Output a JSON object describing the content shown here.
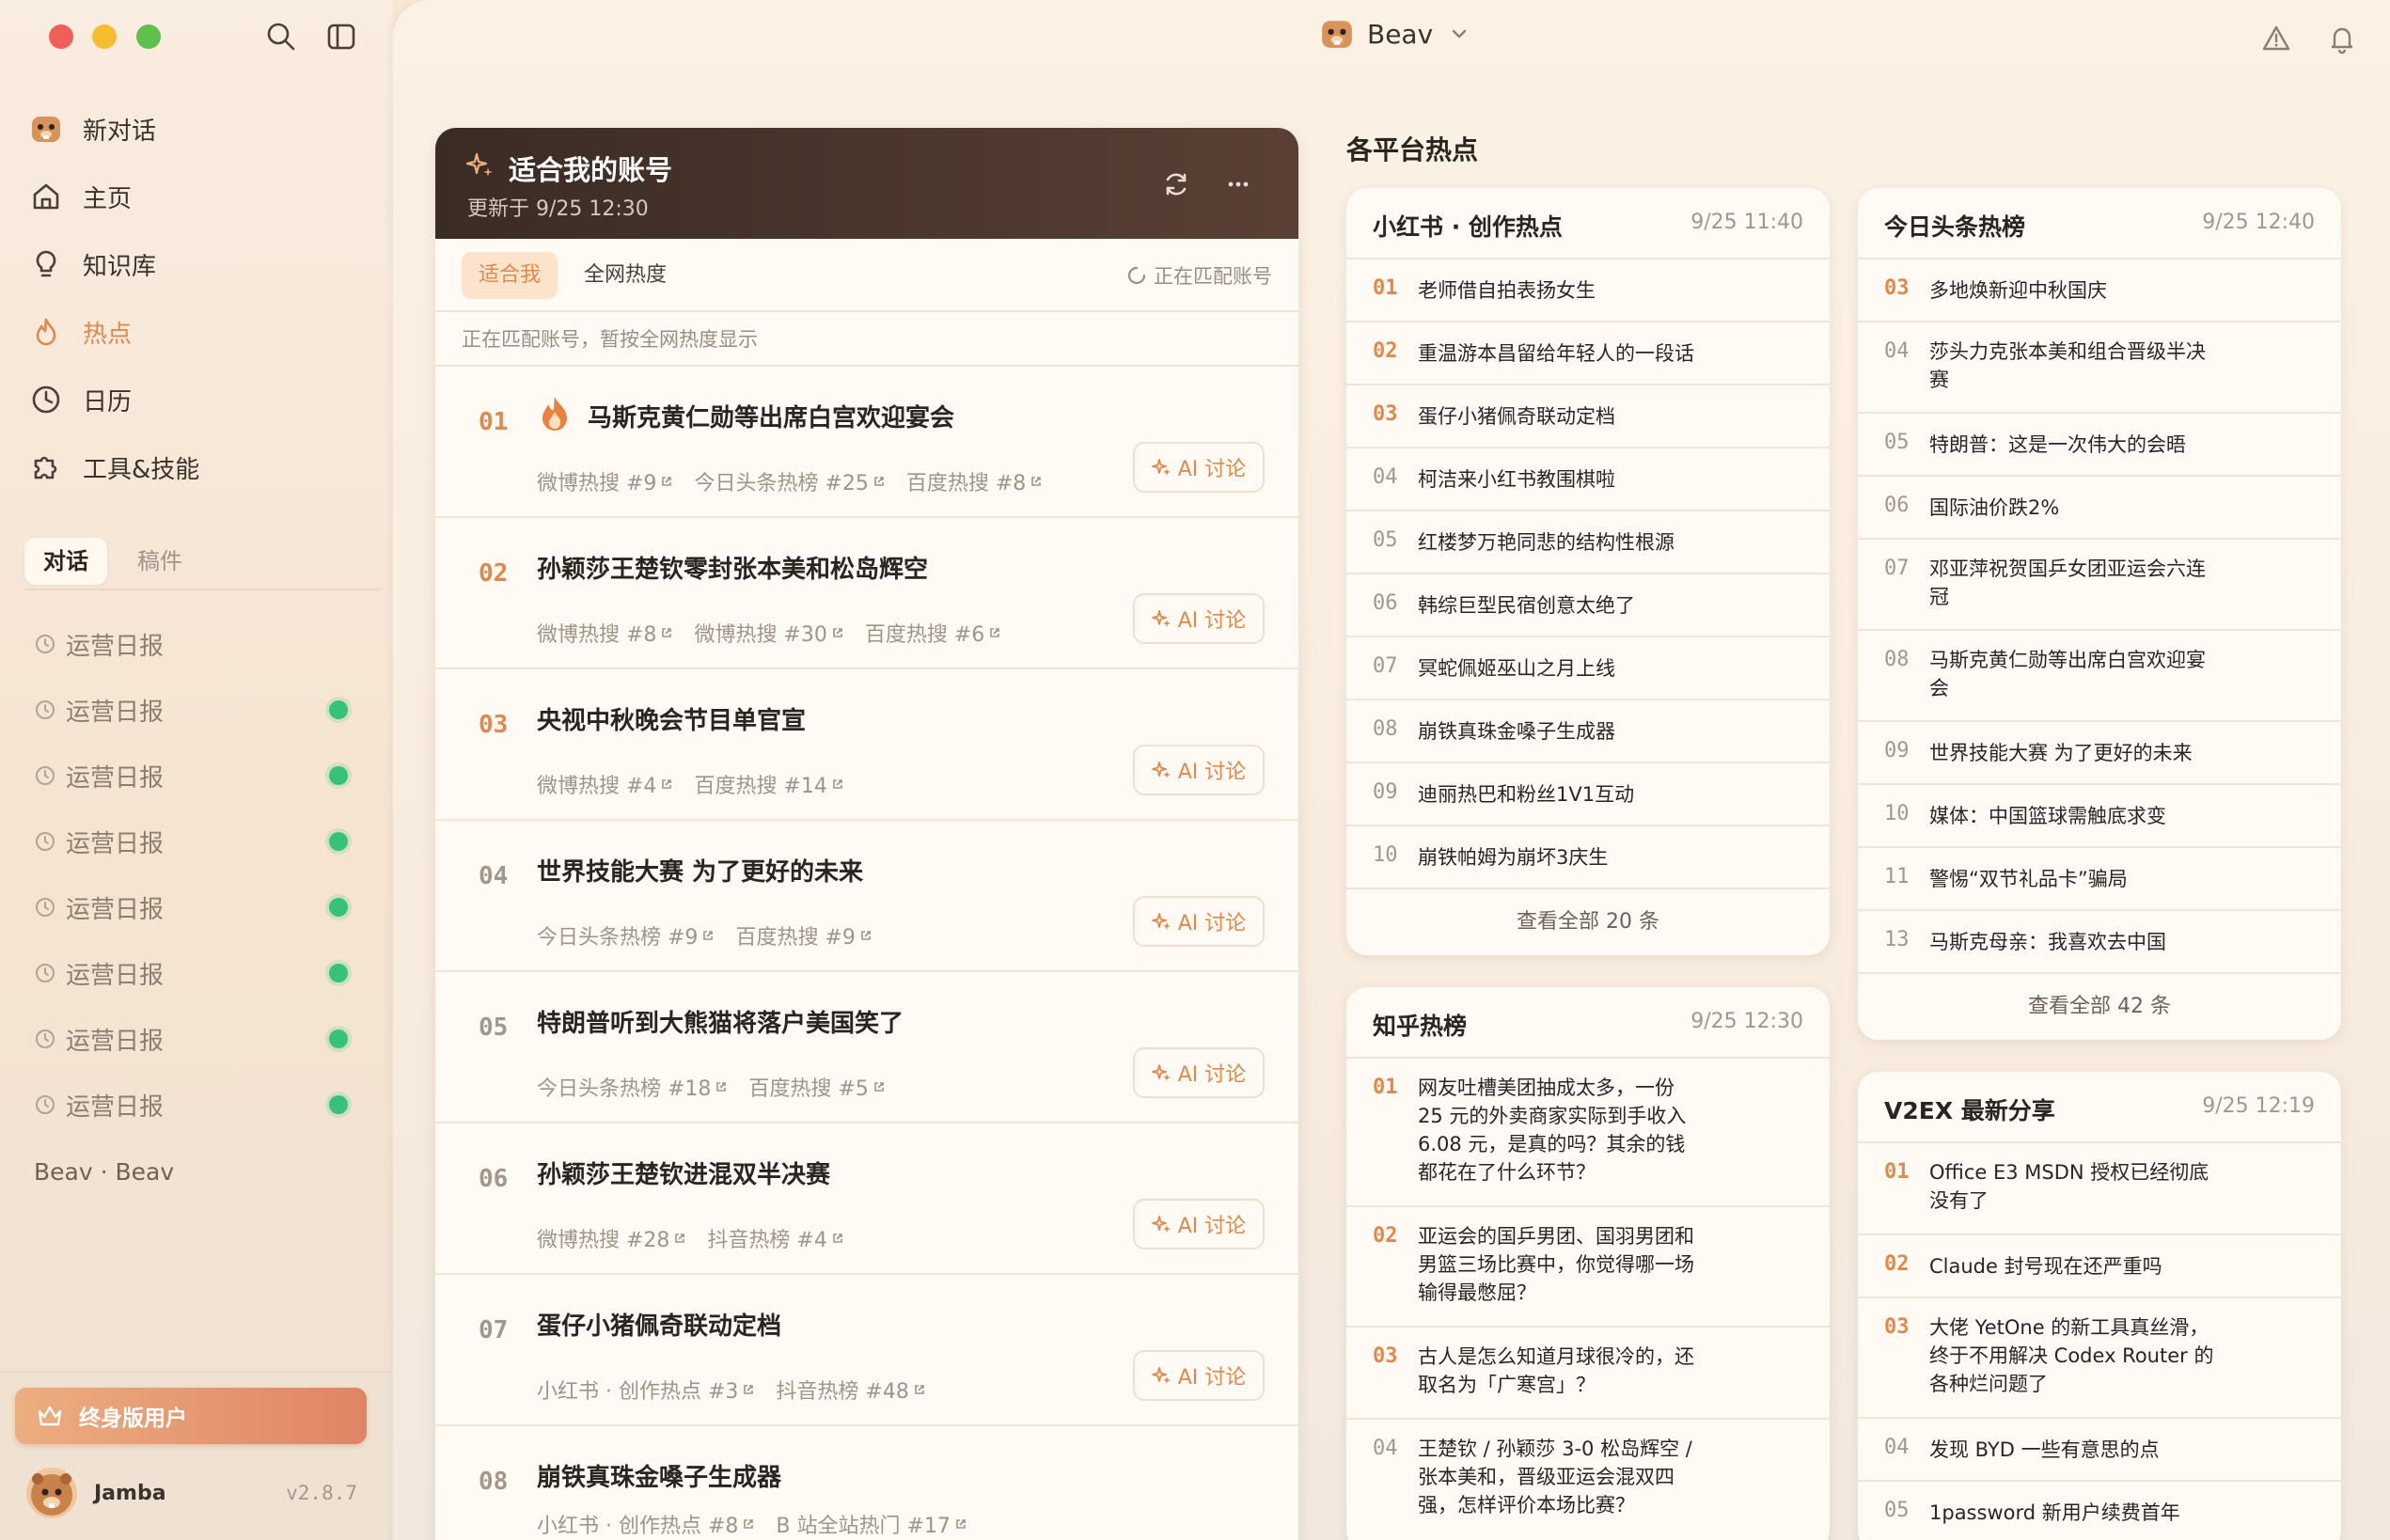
{
  "sidebar": {
    "nav": [
      {
        "label": "新对话",
        "icon": "beaver-icon"
      },
      {
        "label": "主页",
        "icon": "home-icon"
      },
      {
        "label": "知识库",
        "icon": "lightbulb-icon"
      },
      {
        "label": "热点",
        "icon": "flame-icon",
        "active": true
      },
      {
        "label": "日历",
        "icon": "clock-icon"
      },
      {
        "label": "工具&技能",
        "icon": "puzzle-icon"
      }
    ],
    "tabs": [
      "对话",
      "稿件"
    ],
    "history": [
      {
        "label": "运营日报",
        "dot": false
      },
      {
        "label": "运营日报",
        "dot": true
      },
      {
        "label": "运营日报",
        "dot": true
      },
      {
        "label": "运营日报",
        "dot": true
      },
      {
        "label": "运营日报",
        "dot": true
      },
      {
        "label": "运营日报",
        "dot": true
      },
      {
        "label": "运营日报",
        "dot": true
      },
      {
        "label": "运营日报",
        "dot": true
      }
    ],
    "footer_label": "Beav · Beav",
    "vip_label": "终身版用户",
    "user": {
      "name": "Jamba",
      "version": "v2.8.7"
    }
  },
  "header": {
    "title": "Beav"
  },
  "featured": {
    "title": "适合我的账号",
    "updated": "更新于 9/25 12:30",
    "filters": [
      "适合我",
      "全网热度"
    ],
    "matching": "正在匹配账号",
    "notice": "正在匹配账号，暂按全网热度显示",
    "ai_label": "AI 讨论",
    "items": [
      {
        "num": "01",
        "title": "马斯克黄仁勋等出席白宫欢迎宴会",
        "fire": true,
        "tags": [
          "微博热搜 #9",
          "今日头条热榜 #25",
          "百度热搜 #8"
        ]
      },
      {
        "num": "02",
        "title": "孙颖莎王楚钦零封张本美和松岛辉空",
        "tags": [
          "微博热搜 #8",
          "微博热搜 #30",
          "百度热搜 #6"
        ]
      },
      {
        "num": "03",
        "title": "央视中秋晚会节目单官宣",
        "tags": [
          "微博热搜 #4",
          "百度热搜 #14"
        ]
      },
      {
        "num": "04",
        "title": "世界技能大赛 为了更好的未来",
        "tags": [
          "今日头条热榜 #9",
          "百度热搜 #9"
        ]
      },
      {
        "num": "05",
        "title": "特朗普听到大熊猫将落户美国笑了",
        "tags": [
          "今日头条热榜 #18",
          "百度热搜 #5"
        ]
      },
      {
        "num": "06",
        "title": "孙颖莎王楚钦进混双半决赛",
        "tags": [
          "微博热搜 #28",
          "抖音热榜 #4"
        ]
      },
      {
        "num": "07",
        "title": "蛋仔小猪佩奇联动定档",
        "tags": [
          "小红书 · 创作热点 #3",
          "抖音热榜 #48"
        ]
      },
      {
        "num": "08",
        "title": "崩铁真珠金嗓子生成器",
        "tags": [
          "小红书 · 创作热点 #8",
          "B 站全站热门 #17"
        ]
      }
    ]
  },
  "platforms_title": "各平台热点",
  "platforms": [
    {
      "name": "小红书 · 创作热点",
      "time": "9/25 11:40",
      "footer": "查看全部 20 条",
      "items": [
        {
          "n": "01",
          "t": [
            "老师借自拍表扬女生"
          ]
        },
        {
          "n": "02",
          "t": [
            "重温游本昌留给年轻人的一段话"
          ]
        },
        {
          "n": "03",
          "t": [
            "蛋仔小猪佩奇联动定档"
          ]
        },
        {
          "n": "04",
          "t": [
            "柯洁来小红书教围棋啦"
          ]
        },
        {
          "n": "05",
          "t": [
            "红楼梦万艳同悲的结构性根源"
          ]
        },
        {
          "n": "06",
          "t": [
            "韩综巨型民宿创意太绝了"
          ]
        },
        {
          "n": "07",
          "t": [
            "冥蛇佩姬巫山之月上线"
          ]
        },
        {
          "n": "08",
          "t": [
            "崩铁真珠金嗓子生成器"
          ]
        },
        {
          "n": "09",
          "t": [
            "迪丽热巴和粉丝1V1互动"
          ]
        },
        {
          "n": "10",
          "t": [
            "崩铁帕姆为崩坏3庆生"
          ]
        }
      ]
    },
    {
      "name": "今日头条热榜",
      "time": "9/25 12:40",
      "footer": "查看全部 42 条",
      "items": [
        {
          "n": "03",
          "t": [
            "多地焕新迎中秋国庆"
          ]
        },
        {
          "n": "04",
          "t": [
            "莎头力克张本美和组合晋级半决",
            "赛"
          ]
        },
        {
          "n": "05",
          "t": [
            "特朗普：这是一次伟大的会晤"
          ]
        },
        {
          "n": "06",
          "t": [
            "国际油价跌2%"
          ]
        },
        {
          "n": "07",
          "t": [
            "邓亚萍祝贺国乒女团亚运会六连",
            "冠"
          ]
        },
        {
          "n": "08",
          "t": [
            "马斯克黄仁勋等出席白宫欢迎宴",
            "会"
          ]
        },
        {
          "n": "09",
          "t": [
            "世界技能大赛 为了更好的未来"
          ]
        },
        {
          "n": "10",
          "t": [
            "媒体：中国篮球需触底求变"
          ]
        },
        {
          "n": "11",
          "t": [
            "警惕“双节礼品卡”骗局"
          ]
        },
        {
          "n": "13",
          "t": [
            "马斯克母亲：我喜欢去中国"
          ]
        }
      ]
    },
    {
      "name": "知乎热榜",
      "time": "9/25 12:30",
      "items": [
        {
          "n": "01",
          "t": [
            "网友吐槽美团抽成太多，一份",
            "25 元的外卖商家实际到手收入",
            "6.08 元，是真的吗？其余的钱",
            "都花在了什么环节？"
          ]
        },
        {
          "n": "02",
          "t": [
            "亚运会的国乒男团、国羽男团和",
            "男篮三场比赛中，你觉得哪一场",
            "输得最憋屈？"
          ]
        },
        {
          "n": "03",
          "t": [
            "古人是怎么知道月球很冷的，还",
            "取名为「广寒宫」？"
          ]
        },
        {
          "n": "04",
          "t": [
            "王楚钦 / 孙颖莎 3-0 松岛辉空 /",
            "张本美和，晋级亚运会混双四",
            "强，怎样评价本场比赛？"
          ]
        }
      ]
    },
    {
      "name": "V2EX 最新分享",
      "time": "9/25 12:19",
      "items": [
        {
          "n": "01",
          "t": [
            "Office E3 MSDN 授权已经彻底",
            "没有了"
          ]
        },
        {
          "n": "02",
          "t": [
            "Claude 封号现在还严重吗"
          ]
        },
        {
          "n": "03",
          "t": [
            "大佬 YetOne 的新工具真丝滑，",
            "终于不用解决 Codex Router 的",
            "各种烂问题了"
          ]
        },
        {
          "n": "04",
          "t": [
            "发现 BYD 一些有意思的点"
          ]
        },
        {
          "n": "05",
          "t": [
            "1password 新用户续费首年"
          ]
        }
      ]
    }
  ]
}
